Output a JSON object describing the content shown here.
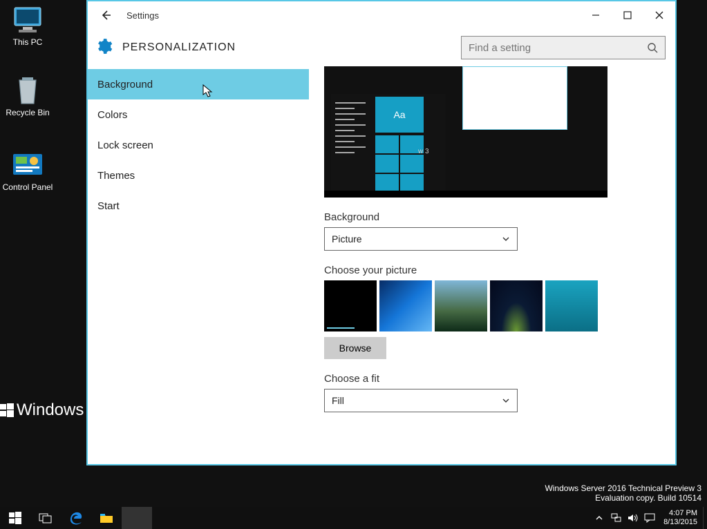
{
  "desktop": {
    "this_pc": "This PC",
    "recycle_bin": "Recycle Bin",
    "control_panel": "Control Panel",
    "watermark_line1": "Windows Server 2016 Technical Preview 3",
    "watermark_line2": "Evaluation copy. Build 10514",
    "big_watermark": "Windows Se"
  },
  "settings": {
    "titlebar": "Settings",
    "header": "PERSONALIZATION",
    "search_placeholder": "Find a setting",
    "sidebar": {
      "background": "Background",
      "colors": "Colors",
      "lockscreen": "Lock screen",
      "themes": "Themes",
      "start": "Start"
    },
    "preview_sample_text": "Aa",
    "preview_caption": "w 3",
    "background_label": "Background",
    "background_value": "Picture",
    "choose_picture_label": "Choose your picture",
    "browse_label": "Browse",
    "choose_fit_label": "Choose a fit",
    "fit_value": "Fill"
  },
  "taskbar": {
    "time": "4:07 PM",
    "date": "8/13/2015"
  }
}
